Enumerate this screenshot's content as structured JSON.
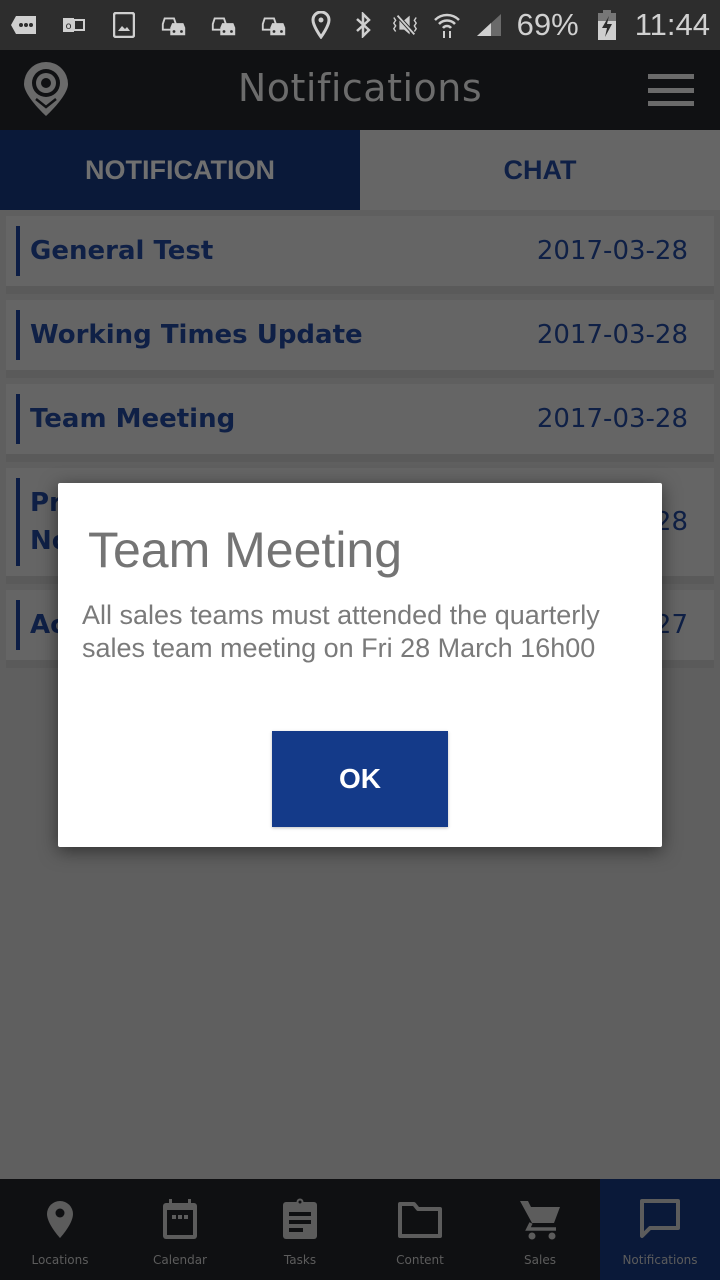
{
  "status_bar": {
    "left_icons": [
      "more-notifications-icon",
      "outlook-icon",
      "gallery-icon",
      "traffic-icon",
      "traffic-icon",
      "traffic-icon"
    ],
    "right_icons": [
      "location-icon",
      "bluetooth-icon",
      "mute-vibrate-icon",
      "wifi-icon",
      "signal-icon"
    ],
    "battery": "69%",
    "time": "11:44"
  },
  "app_bar": {
    "title": "Notifications",
    "logo_icon": "map-pin-logo-icon",
    "menu_icon": "hamburger-menu-icon"
  },
  "tabs": [
    {
      "label": "NOTIFICATION",
      "active": true
    },
    {
      "label": "CHAT",
      "active": false
    }
  ],
  "notifications": [
    {
      "title": "General Test",
      "date": "2017-03-28"
    },
    {
      "title": "Working Times Update",
      "date": "2017-03-28"
    },
    {
      "title": "Team Meeting",
      "date": "2017-03-28"
    },
    {
      "title_line1": "Pr",
      "title_line2": "No",
      "date": "28"
    },
    {
      "title": "Ac",
      "date": "27"
    }
  ],
  "dialog": {
    "title": "Team Meeting",
    "body": "All sales teams must attended the quarterly sales team meeting on Fri 28 March 16h00",
    "ok_label": "OK"
  },
  "bottom_nav": [
    {
      "label": "Locations",
      "icon": "location-pin-icon",
      "active": false
    },
    {
      "label": "Calendar",
      "icon": "calendar-icon",
      "active": false
    },
    {
      "label": "Tasks",
      "icon": "clipboard-icon",
      "active": false
    },
    {
      "label": "Content",
      "icon": "folder-icon",
      "active": false
    },
    {
      "label": "Sales",
      "icon": "cart-icon",
      "active": false
    },
    {
      "label": "Notifications",
      "icon": "chat-bubble-icon",
      "active": true
    }
  ],
  "colors": {
    "primary_dark": "#0a1939",
    "primary_button": "#143a89",
    "overlay_dim": "#5f5f5f"
  }
}
